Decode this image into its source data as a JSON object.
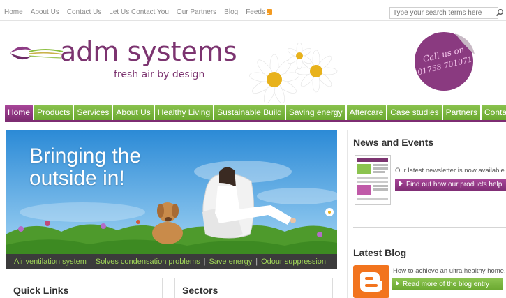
{
  "top_nav": {
    "links": [
      "Home",
      "About Us",
      "Contact Us",
      "Let Us Contact You",
      "Our Partners",
      "Blog",
      "Feeds"
    ]
  },
  "search": {
    "placeholder": "Type your search terms here"
  },
  "brand": {
    "name": "adm systems",
    "tagline": "fresh air by design",
    "call_line1": "Call us on",
    "call_line2": "01758 701071",
    "colors": {
      "purple": "#7c3470",
      "green": "#7ab83e"
    }
  },
  "main_nav": {
    "items": [
      "Home",
      "Products",
      "Services",
      "About Us",
      "Healthy Living",
      "Sustainable Build",
      "Saving energy",
      "Aftercare",
      "Case studies",
      "Partners",
      "Contact"
    ],
    "active": "Home"
  },
  "hero": {
    "title_line1": "Bringing the",
    "title_line2": "outside in!",
    "caption_items": [
      "Air ventilation system",
      "Solves condensation problems",
      "Save energy",
      "Odour suppression"
    ],
    "caption_separator": "|"
  },
  "panels": {
    "quick_links_title": "Quick Links",
    "sectors_title": "Sectors"
  },
  "news": {
    "title": "News and Events",
    "text": "Our latest newsletter is now available...",
    "button": "Find out how our products help"
  },
  "blog": {
    "title": "Latest Blog",
    "text": "How to achieve an ultra healthy home...",
    "button": "Read more of the blog entry"
  },
  "icons": [
    "rss-icon",
    "search-icon",
    "arrow-icon",
    "blogger-icon"
  ]
}
